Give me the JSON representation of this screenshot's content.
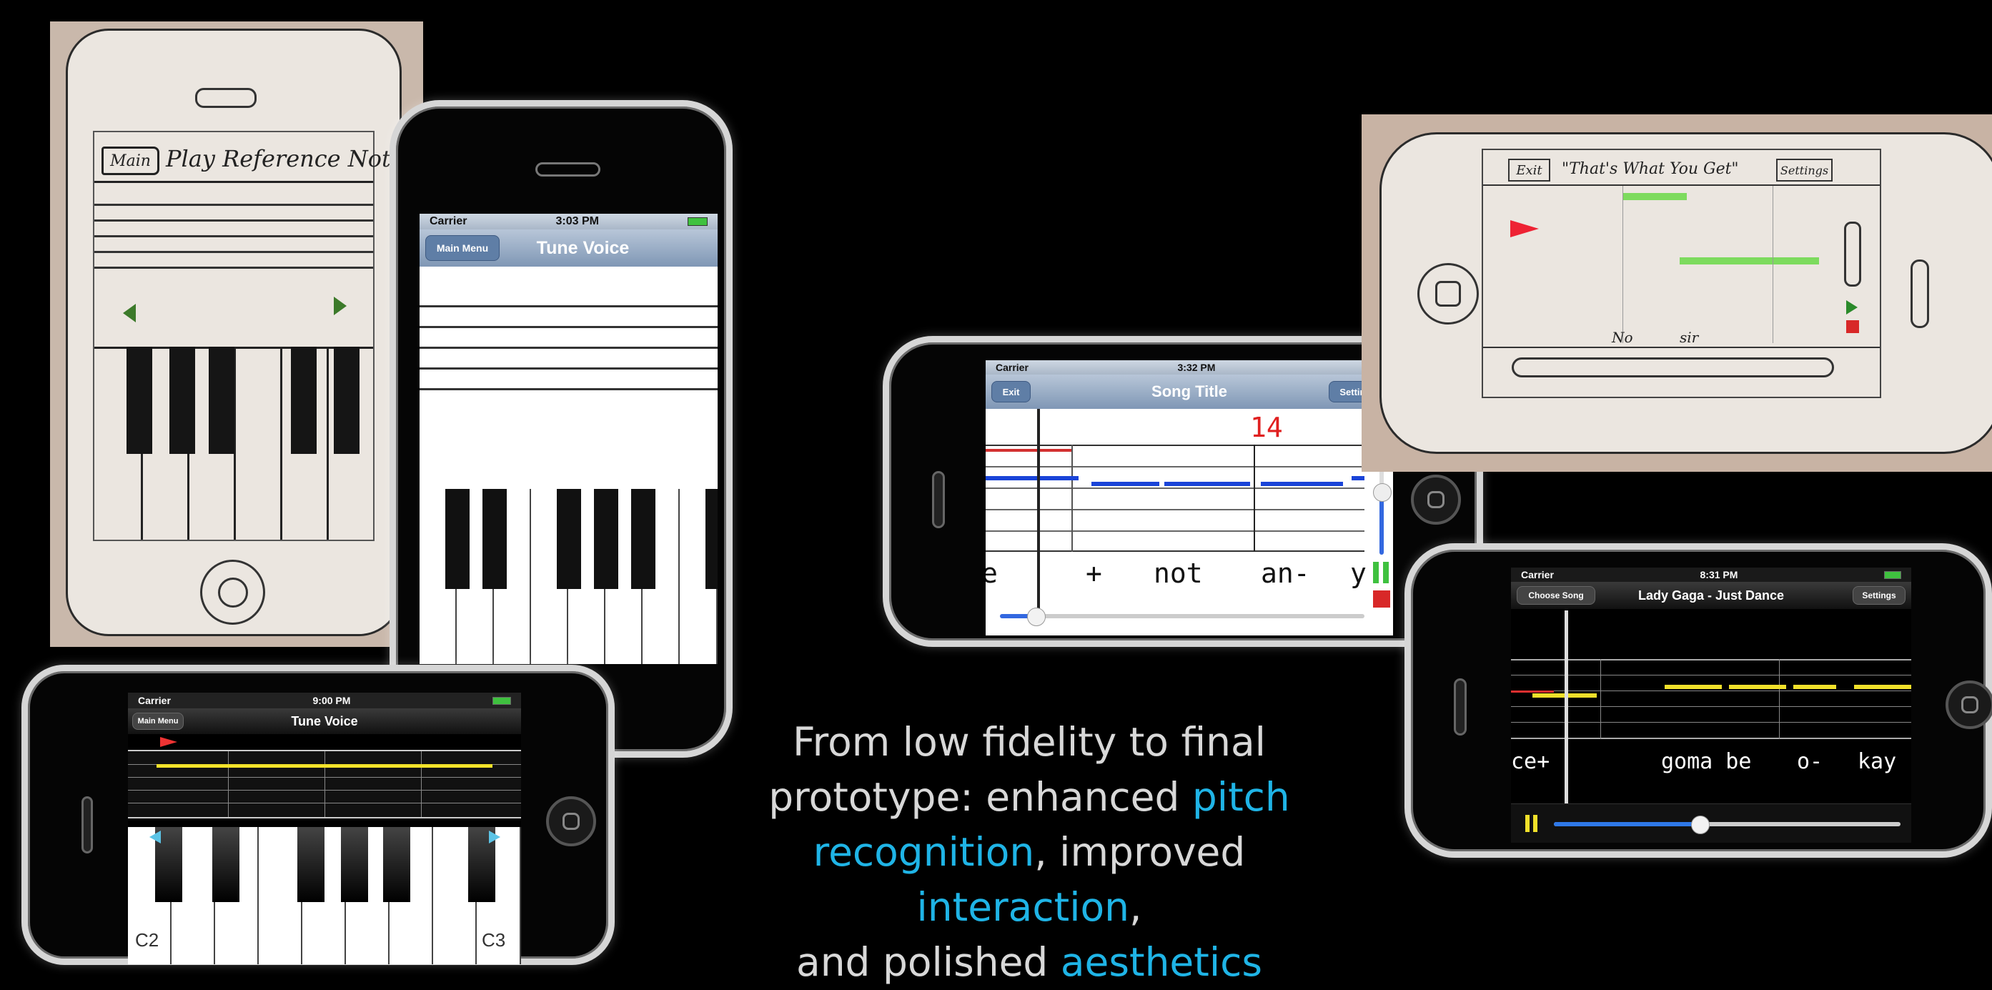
{
  "colors": {
    "accent": "#1fb4e6",
    "caption": "#d8d8d8",
    "background": "#000000"
  },
  "sketch_vertical": {
    "back_label": "Main",
    "title": "Play Reference Note",
    "left_arrow_icon": "triangle-left-icon",
    "right_arrow_icon": "triangle-right-icon"
  },
  "phone_tune_voice_portrait": {
    "carrier": "Carrier",
    "time": "3:03 PM",
    "back_button": "Main Menu",
    "title": "Tune Voice"
  },
  "phone_tune_voice_landscape": {
    "carrier": "Carrier",
    "time": "9:00 PM",
    "back_button": "Main Menu",
    "title": "Tune Voice",
    "key_low": "C2",
    "key_high": "C3"
  },
  "phone_song_title": {
    "carrier": "Carrier",
    "time": "3:32 PM",
    "exit_button": "Exit",
    "title": "Song Title",
    "settings_button": "Settings",
    "score": "14",
    "lyrics": [
      "e",
      "+",
      "not",
      "an-",
      "y"
    ]
  },
  "sketch_horizontal": {
    "exit_label": "Exit",
    "title": "\"That's What You Get\"",
    "settings_label": "Settings",
    "lyrics": [
      "No",
      "sir"
    ]
  },
  "phone_lady_gaga": {
    "carrier": "Carrier",
    "time": "8:31 PM",
    "choose_button": "Choose Song",
    "title": "Lady Gaga - Just Dance",
    "settings_button": "Settings",
    "lyrics": [
      "ce+",
      "goma be",
      "o-",
      "kay"
    ],
    "progress": 0.42
  },
  "caption": {
    "line1": "From low fidelity to final",
    "line2_a": "prototype: enhanced ",
    "line2_b": "pitch",
    "line3_a": "recognition",
    "line3_b": ", improved ",
    "line3_c": "interaction",
    "line3_d": ",",
    "line4_a": "and polished ",
    "line4_b": "aesthetics"
  }
}
